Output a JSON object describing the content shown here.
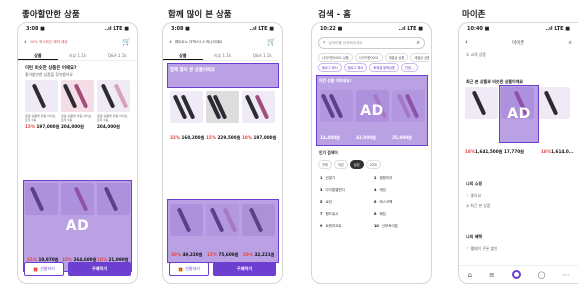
{
  "captions": [
    "좋아할만한 상품",
    "함께 많이 본 상품",
    "검색 - 홈",
    "마이존"
  ],
  "status": {
    "time1": "3:08 ■",
    "time2": "3:08 ■",
    "time3": "10:22 ■",
    "time4": "10:40 ■",
    "signal": "..ıl LTE ■"
  },
  "screen1": {
    "title": "10% 적시하인 예약 제공",
    "tabs": [
      "상품",
      "리뷰 1.1k",
      "Q&A 1.1k"
    ],
    "heading": "이런 비슷한 상품은 어때요?",
    "subheading": "좋아할만한 상품을 찾아봤어요",
    "products": [
      {
        "name": "글림 상품명 슬림 아이브로우 5종",
        "price": "197,000원",
        "dc": "15%"
      },
      {
        "name": "글림 상품명 슬림 아이브로우 5종",
        "price": "204,000원",
        "dc": "10%"
      },
      {
        "name": "글림 상품명 슬림 아이브로우 5종",
        "price": "204,000원",
        "dc": "10%"
      }
    ],
    "bottom_prices": [
      {
        "dc": "15%",
        "price": "10,970원"
      },
      {
        "dc": "10%",
        "price": "264,600원"
      },
      {
        "dc": "10%",
        "price": "21,990원"
      }
    ],
    "ad": "AD",
    "gift": "선물하기",
    "buy": "구매하기"
  },
  "screen2": {
    "title": "웨이트노 더맥스2.0 하나리세트",
    "tabs": [
      "상품",
      "리뷰 1.1k",
      "Q&A 1.1k"
    ],
    "heading": "함께 많이 본 상품이에요",
    "prices": [
      {
        "dc": "32%",
        "price": "160,200원"
      },
      {
        "dc": "15%",
        "price": "229,500원"
      },
      {
        "dc": "10%",
        "price": "197,000원"
      }
    ],
    "bottom_prices": [
      {
        "dc": "30%",
        "price": "49,220원"
      },
      {
        "dc": "15%",
        "price": "75,600원"
      },
      {
        "dc": "20%",
        "price": "32,221원"
      }
    ],
    "ad": "AD",
    "gift": "선물하기",
    "buy": "구매하기"
  },
  "screen3": {
    "search_placeholder": "검색어를 입력해주세요",
    "chips1": [
      "나이키퀸0001 상품",
      "나이키퀸0002",
      "계절상 상품",
      "계절상 상품"
    ],
    "chips2": [
      "블로그 해서",
      "블로그 해서",
      "화제셀 블랙상품",
      "안녕..."
    ],
    "section": "이런 상품 어떠세요?",
    "ad": "AD",
    "prices": [
      "14,400원",
      "43,900원",
      "35,900원"
    ],
    "ranking_title": "인기 검색어",
    "ranking_tabs": [
      "전체",
      "여성",
      "남성",
      "20대"
    ],
    "ranks": [
      [
        "1",
        "산딸기"
      ],
      [
        "2",
        "캠핑의자"
      ],
      [
        "3",
        "다이얼캘린더"
      ],
      [
        "4",
        "재킷"
      ],
      [
        "5",
        "로션"
      ],
      [
        "6",
        "마스크팩"
      ],
      [
        "7",
        "핸드워시"
      ],
      [
        "8",
        "패딩"
      ],
      [
        "9",
        "트렌치코트"
      ],
      [
        "10",
        "산모토이폰"
      ]
    ]
  },
  "screen4": {
    "title": "마이존",
    "subtitle": "오 교육 상품",
    "heading": "최근 본 상품과 비슷한 상품이에요",
    "ad": "AD",
    "prices": [
      {
        "dc": "18%",
        "price": "1,641,500원"
      },
      {
        "dc": "",
        "price": "17,770원"
      },
      {
        "dc": "18%",
        "price": "1,614,0..."
      }
    ],
    "myshop": "나의 쇼핑",
    "myshop_items": [
      "♡ 좋아요",
      "◎ 최근 본 상품"
    ],
    "benefit": "나의 혜택",
    "benefit_item": "♡ 웰메이 쿠폰 할인"
  }
}
